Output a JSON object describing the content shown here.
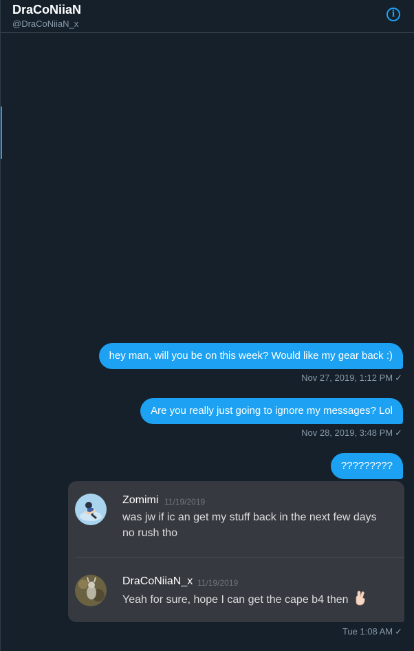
{
  "header": {
    "name": "DraCoNiiaN",
    "handle": "@DraCoNiiaN_x",
    "info_icon": "info-icon"
  },
  "messages": [
    {
      "text": "hey man, will you be on this week? Would like my gear back :)",
      "timestamp": "Nov 27, 2019, 1:12 PM"
    },
    {
      "text": "Are you really just going to ignore my messages? Lol",
      "timestamp": "Nov 28, 2019, 3:48 PM"
    },
    {
      "text": "?????????",
      "timestamp": ""
    }
  ],
  "embed": {
    "entries": [
      {
        "user": "Zomimi",
        "date": "11/19/2019",
        "lines": [
          "was jw if ic an get my stuff back in the next few days",
          "no rush tho"
        ]
      },
      {
        "user": "DraCoNiiaN_x",
        "date": "11/19/2019",
        "lines": [
          "Yeah for sure, hope I can get the cape b4 then"
        ]
      }
    ],
    "timestamp": "Tue 1:08 AM"
  },
  "check_glyph": "✓",
  "colors": {
    "background": "#15202b",
    "bubble": "#1da1f2",
    "embed_bg": "#36393f",
    "muted": "#8899a6"
  }
}
